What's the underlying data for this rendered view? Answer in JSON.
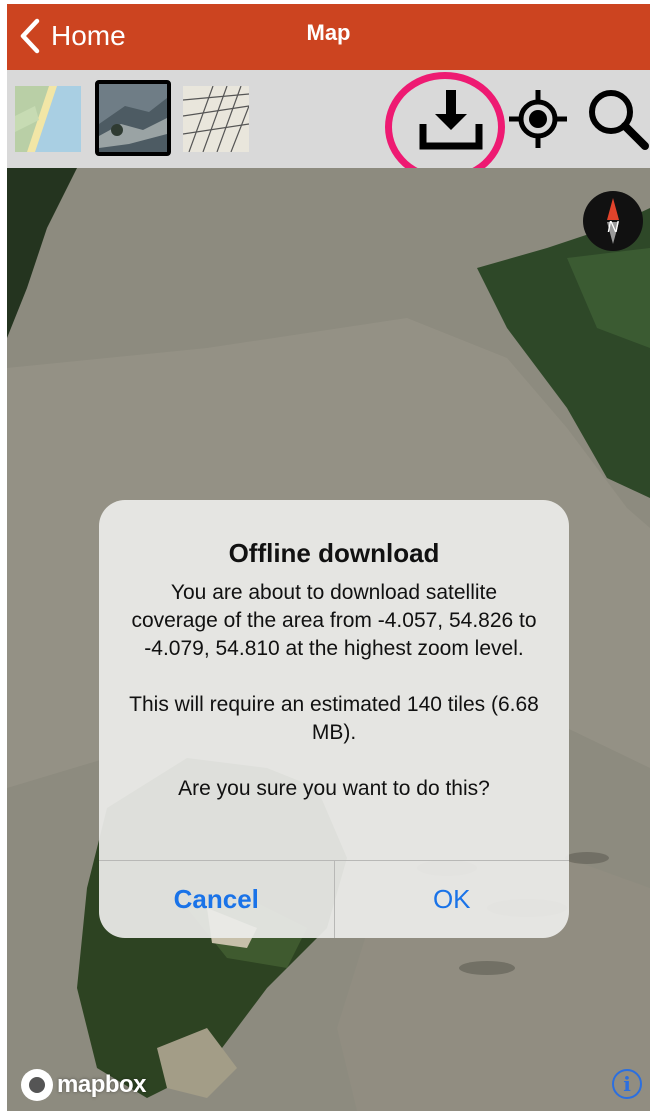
{
  "nav": {
    "back_label": "Home",
    "title": "Map"
  },
  "toolbar": {
    "layers": [
      "street-map-thumbnail",
      "satellite-map-thumbnail",
      "historic-map-thumbnail"
    ],
    "selected_layer": "satellite-map-thumbnail",
    "tools": [
      "download-icon",
      "locate-icon",
      "search-icon"
    ],
    "highlight_color": "#ee1a72"
  },
  "map": {
    "compass_label": "N",
    "attribution": "mapbox",
    "info_label": "i"
  },
  "dialog": {
    "title": "Offline download",
    "message": "You are about to download satellite coverage of the area from -4.057, 54.826 to -4.079, 54.810 at the highest zoom level.",
    "estimate": "This will require an estimated 140 tiles (6.68 MB).",
    "question": "Are you sure you want to do this?",
    "cancel_label": "Cancel",
    "ok_label": "OK"
  },
  "colors": {
    "nav_bar": "#cc4420",
    "toolbar": "#d9d9d9",
    "button_blue": "#1a73e8"
  }
}
